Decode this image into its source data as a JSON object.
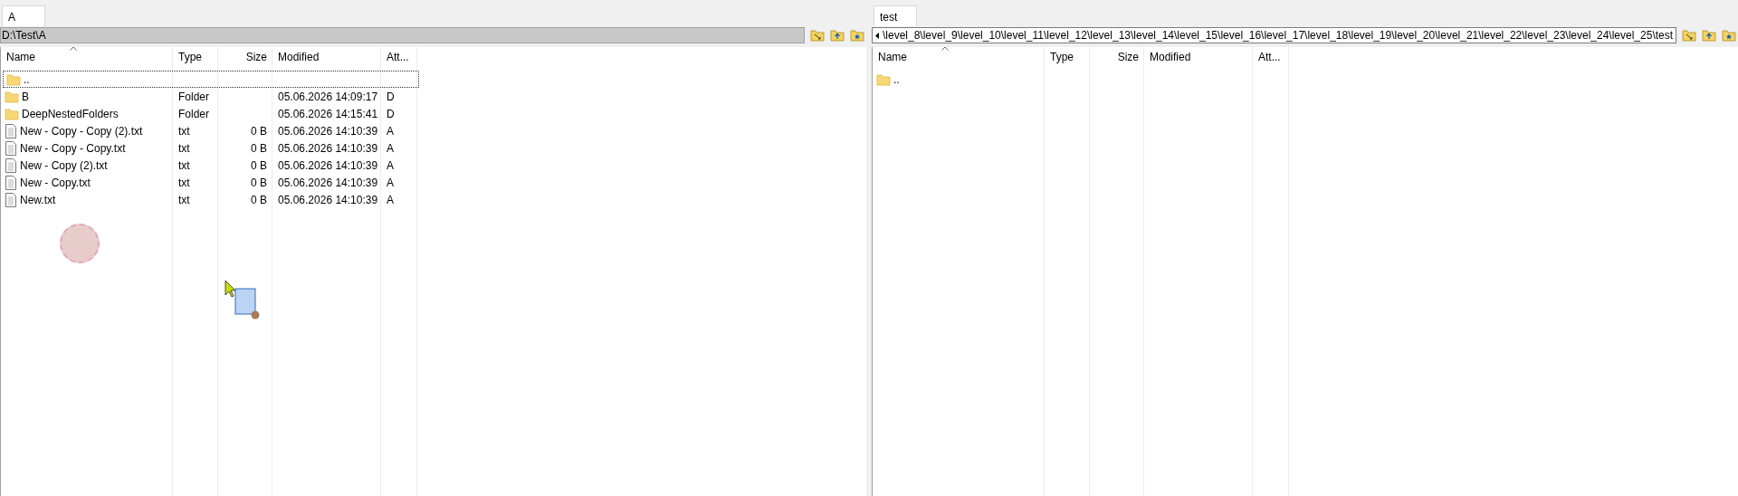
{
  "panels": [
    {
      "tab": {
        "label": "A",
        "selected": true
      },
      "path": "D:\\Test\\A",
      "active": true,
      "path_scrolled": false,
      "columns": [
        {
          "label": "Name",
          "sorted": true
        },
        {
          "label": "Type",
          "sorted": false
        },
        {
          "label": "Size",
          "sorted": false
        },
        {
          "label": "Modified",
          "sorted": false
        },
        {
          "label": "Att...",
          "sorted": false
        }
      ],
      "rows": [
        {
          "kind": "parent",
          "name": "..",
          "type": "",
          "size": "",
          "modified": "",
          "attr": "",
          "focused": true
        },
        {
          "kind": "folder",
          "name": "B",
          "type": "Folder",
          "size": "",
          "modified": "05.06.2026 14:09:17",
          "attr": "D",
          "focused": false
        },
        {
          "kind": "folder",
          "name": "DeepNestedFolders",
          "type": "Folder",
          "size": "",
          "modified": "05.06.2026 14:15:41",
          "attr": "D",
          "focused": false
        },
        {
          "kind": "file",
          "name": "New - Copy - Copy (2).txt",
          "type": "txt",
          "size": "0 B",
          "modified": "05.06.2026 14:10:39",
          "attr": "A",
          "focused": false
        },
        {
          "kind": "file",
          "name": "New - Copy - Copy.txt",
          "type": "txt",
          "size": "0 B",
          "modified": "05.06.2026 14:10:39",
          "attr": "A",
          "focused": false
        },
        {
          "kind": "file",
          "name": "New - Copy (2).txt",
          "type": "txt",
          "size": "0 B",
          "modified": "05.06.2026 14:10:39",
          "attr": "A",
          "focused": false
        },
        {
          "kind": "file",
          "name": "New - Copy.txt",
          "type": "txt",
          "size": "0 B",
          "modified": "05.06.2026 14:10:39",
          "attr": "A",
          "focused": false
        },
        {
          "kind": "file",
          "name": "New.txt",
          "type": "txt",
          "size": "0 B",
          "modified": "05.06.2026 14:10:39",
          "attr": "A",
          "focused": false
        }
      ]
    },
    {
      "tab": {
        "label": "test",
        "selected": true
      },
      "path": "\\level_8\\level_9\\level_10\\level_11\\level_12\\level_13\\level_14\\level_15\\level_16\\level_17\\level_18\\level_19\\level_20\\level_21\\level_22\\level_23\\level_24\\level_25\\test",
      "active": false,
      "path_scrolled": true,
      "columns": [
        {
          "label": "Name",
          "sorted": true
        },
        {
          "label": "Type",
          "sorted": false
        },
        {
          "label": "Size",
          "sorted": false
        },
        {
          "label": "Modified",
          "sorted": false
        },
        {
          "label": "Att...",
          "sorted": false
        }
      ],
      "rows": [
        {
          "kind": "parent",
          "name": "..",
          "type": "",
          "size": "",
          "modified": "",
          "attr": "",
          "focused": false
        }
      ]
    }
  ]
}
